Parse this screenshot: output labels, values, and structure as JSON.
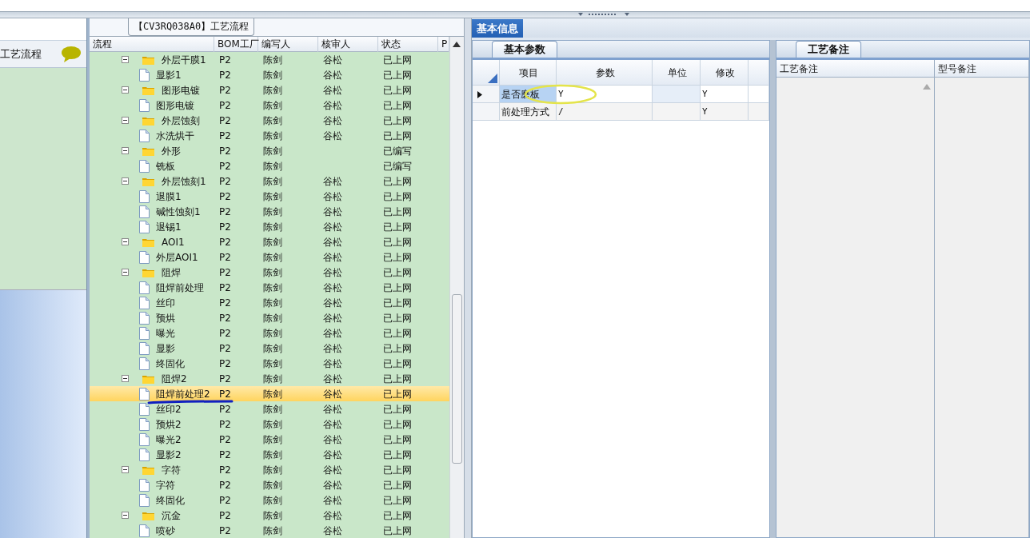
{
  "left_panel": {
    "title": "工艺流程"
  },
  "process_panel": {
    "title": "【CV3RQ038A0】工艺流程",
    "columns": [
      "流程",
      "BOM工厂",
      "编写人",
      "核审人",
      "状态",
      "P"
    ],
    "rows": [
      {
        "name": "外层干膜1",
        "factory": "P2",
        "writer": "陈剑",
        "reviewer": "谷松",
        "status": "已上网",
        "selected": false,
        "expanded": true,
        "children": [
          {
            "name": "显影1",
            "factory": "P2",
            "writer": "陈剑",
            "reviewer": "谷松",
            "status": "已上网",
            "selected": false
          }
        ]
      },
      {
        "name": "图形电镀",
        "factory": "P2",
        "writer": "陈剑",
        "reviewer": "谷松",
        "status": "已上网",
        "selected": false,
        "expanded": true,
        "children": [
          {
            "name": "图形电镀",
            "factory": "P2",
            "writer": "陈剑",
            "reviewer": "谷松",
            "status": "已上网",
            "selected": false
          }
        ]
      },
      {
        "name": "外层蚀刻",
        "factory": "P2",
        "writer": "陈剑",
        "reviewer": "谷松",
        "status": "已上网",
        "selected": false,
        "expanded": true,
        "children": [
          {
            "name": "水洗烘干",
            "factory": "P2",
            "writer": "陈剑",
            "reviewer": "谷松",
            "status": "已上网",
            "selected": false
          }
        ]
      },
      {
        "name": "外形",
        "factory": "P2",
        "writer": "陈剑",
        "status": "已编写",
        "selected": false,
        "expanded": true,
        "children": [
          {
            "name": "铣板",
            "factory": "P2",
            "writer": "陈剑",
            "status": "已编写",
            "selected": false
          }
        ]
      },
      {
        "name": "外层蚀刻1",
        "factory": "P2",
        "writer": "陈剑",
        "reviewer": "谷松",
        "status": "已上网",
        "selected": false,
        "expanded": true,
        "children": [
          {
            "name": "退膜1",
            "factory": "P2",
            "writer": "陈剑",
            "reviewer": "谷松",
            "status": "已上网",
            "selected": false
          },
          {
            "name": "碱性蚀刻1",
            "factory": "P2",
            "writer": "陈剑",
            "reviewer": "谷松",
            "status": "已上网",
            "selected": false
          },
          {
            "name": "退锡1",
            "factory": "P2",
            "writer": "陈剑",
            "reviewer": "谷松",
            "status": "已上网",
            "selected": false
          }
        ]
      },
      {
        "name": "AOI1",
        "factory": "P2",
        "writer": "陈剑",
        "reviewer": "谷松",
        "status": "已上网",
        "selected": false,
        "expanded": true,
        "children": [
          {
            "name": "外层AOI1",
            "factory": "P2",
            "writer": "陈剑",
            "reviewer": "谷松",
            "status": "已上网",
            "selected": false
          }
        ]
      },
      {
        "name": "阻焊",
        "factory": "P2",
        "writer": "陈剑",
        "reviewer": "谷松",
        "status": "已上网",
        "selected": false,
        "expanded": true,
        "children": [
          {
            "name": "阻焊前处理",
            "factory": "P2",
            "writer": "陈剑",
            "reviewer": "谷松",
            "status": "已上网",
            "selected": false
          },
          {
            "name": "丝印",
            "factory": "P2",
            "writer": "陈剑",
            "reviewer": "谷松",
            "status": "已上网",
            "selected": false
          },
          {
            "name": "预烘",
            "factory": "P2",
            "writer": "陈剑",
            "reviewer": "谷松",
            "status": "已上网",
            "selected": false
          },
          {
            "name": "曝光",
            "factory": "P2",
            "writer": "陈剑",
            "reviewer": "谷松",
            "status": "已上网",
            "selected": false
          },
          {
            "name": "显影",
            "factory": "P2",
            "writer": "陈剑",
            "reviewer": "谷松",
            "status": "已上网",
            "selected": false
          },
          {
            "name": "终固化",
            "factory": "P2",
            "writer": "陈剑",
            "reviewer": "谷松",
            "status": "已上网",
            "selected": false
          }
        ]
      },
      {
        "name": "阻焊2",
        "factory": "P2",
        "writer": "陈剑",
        "reviewer": "谷松",
        "status": "已上网",
        "selected": false,
        "expanded": true,
        "children": [
          {
            "name": "阻焊前处理2",
            "factory": "P2",
            "writer": "陈剑",
            "reviewer": "谷松",
            "status": "已上网",
            "selected": true
          },
          {
            "name": "丝印2",
            "factory": "P2",
            "writer": "陈剑",
            "reviewer": "谷松",
            "status": "已上网",
            "selected": false
          },
          {
            "name": "预烘2",
            "factory": "P2",
            "writer": "陈剑",
            "reviewer": "谷松",
            "status": "已上网",
            "selected": false
          },
          {
            "name": "曝光2",
            "factory": "P2",
            "writer": "陈剑",
            "reviewer": "谷松",
            "status": "已上网",
            "selected": false
          },
          {
            "name": "显影2",
            "factory": "P2",
            "writer": "陈剑",
            "reviewer": "谷松",
            "status": "已上网",
            "selected": false
          }
        ]
      },
      {
        "name": "字符",
        "factory": "P2",
        "writer": "陈剑",
        "reviewer": "谷松",
        "status": "已上网",
        "selected": false,
        "expanded": true,
        "children": [
          {
            "name": "字符",
            "factory": "P2",
            "writer": "陈剑",
            "reviewer": "谷松",
            "status": "已上网",
            "selected": false
          },
          {
            "name": "终固化",
            "factory": "P2",
            "writer": "陈剑",
            "reviewer": "谷松",
            "status": "已上网",
            "selected": false
          }
        ]
      },
      {
        "name": "沉金",
        "factory": "P2",
        "writer": "陈剑",
        "reviewer": "谷松",
        "status": "已上网",
        "selected": false,
        "expanded": true,
        "children": [
          {
            "name": "喷砂",
            "factory": "P2",
            "writer": "陈剑",
            "reviewer": "谷松",
            "status": "已上网",
            "selected": false
          }
        ]
      }
    ]
  },
  "info_tab": {
    "label": "基本信息",
    "selected": true
  },
  "params_panel": {
    "tab": "基本参数",
    "columns": [
      "项目",
      "参数",
      "单位",
      "修改"
    ],
    "rows": [
      {
        "item": "是否磨板",
        "value": "Y",
        "modified": "Y",
        "selected": true
      },
      {
        "item": "前处理方式",
        "value": "/",
        "modified": "Y",
        "selected": false
      }
    ]
  },
  "notes_panel": {
    "tab": "工艺备注",
    "columns": [
      "工艺备注",
      "型号备注"
    ]
  }
}
